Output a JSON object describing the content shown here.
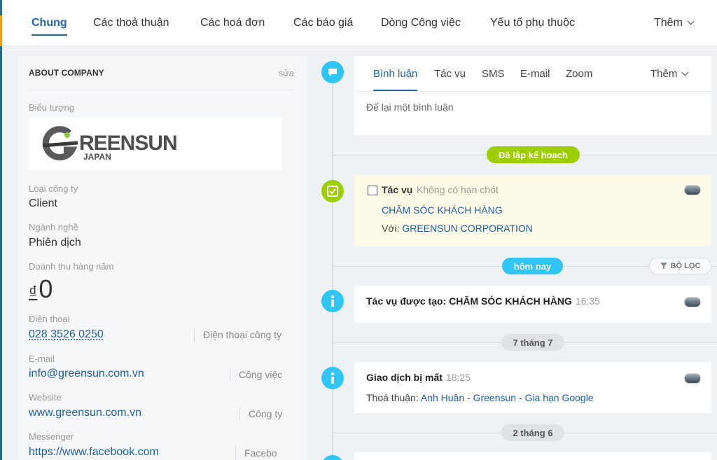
{
  "top_tabs": {
    "items": [
      "Chung",
      "Các thoả thuận",
      "Các hoá đơn",
      "Các báo giá",
      "Dòng Công việc",
      "Yếu tố phụ thuộc"
    ],
    "more": "Thêm"
  },
  "company": {
    "header": "ABOUT COMPANY",
    "edit": "sửa",
    "logo_label": "Biểu tượng",
    "logo": {
      "brand": "REENSUN",
      "sub": "JAPAN",
      "mark": "G"
    },
    "type_label": "Loại công ty",
    "type_value": "Client",
    "industry_label": "Ngành nghề",
    "industry_value": "Phiên dịch",
    "revenue_label": "Doanh thu hàng năm",
    "revenue_currency": "₫",
    "revenue_value": "0",
    "phone_label": "Điện thoại",
    "phone_value": "028 3526 0250",
    "phone_type": "Điện thoại công ty",
    "email_label": "E-mail",
    "email_value": "info@greensun.com.vn",
    "email_type": "Công việc",
    "website_label": "Website",
    "website_value": "www.greensun.com.vn",
    "website_type": "Công ty",
    "messenger_label": "Messenger",
    "messenger_value": "https://www.facebook.com",
    "messenger_type": "Facebo"
  },
  "composer": {
    "tabs": [
      "Bình luận",
      "Tác vụ",
      "SMS",
      "E-mail",
      "Zoom"
    ],
    "more": "Thêm",
    "placeholder": "Để lại một bình luận"
  },
  "timeline": {
    "planned_badge": "Đã lập kế hoạch",
    "task": {
      "label": "Tác vụ",
      "deadline": "Không có hạn chót",
      "name": "CHĂM SÓC KHÁCH HÀNG",
      "with_label": "Với:",
      "with_value": "GREENSUN CORPORATION"
    },
    "today_badge": "hôm nay",
    "filter": "BỘ LỌC",
    "event1": {
      "title": "Tác vụ được tạo: CHĂM SÓC KHÁCH HÀNG",
      "time": "16:35"
    },
    "date1": "7 tháng 7",
    "event2": {
      "title": "Giao dịch bị mất",
      "time": "18:25",
      "deal_label": "Thoả thuận:",
      "deal_parts": [
        "Anh Huân",
        " - ",
        "Greensun",
        " - ",
        "Gia hạn Google"
      ]
    },
    "date2": "2 tháng 6"
  },
  "colors": {
    "accent": "#2067b0",
    "timeline_blue": "#2fc6f6",
    "timeline_green": "#9dcf00",
    "task_bg": "#fdfbe7"
  }
}
